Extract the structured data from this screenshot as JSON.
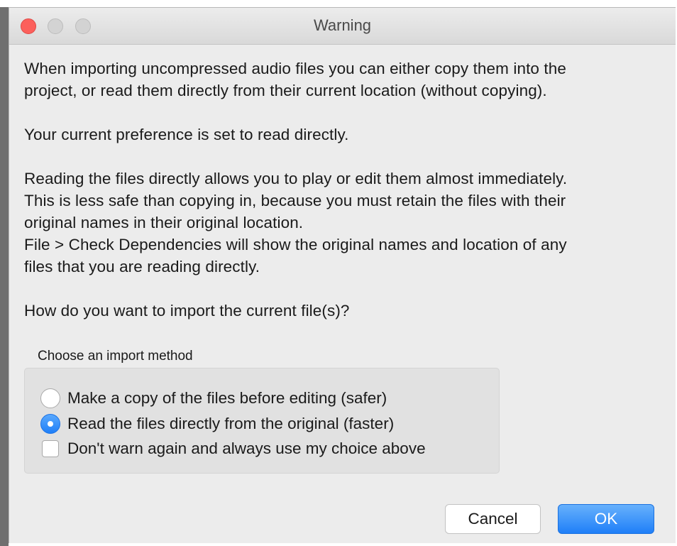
{
  "window": {
    "title": "Warning"
  },
  "message": {
    "para1_line1": "When importing uncompressed audio files you can either copy them into the",
    "para1_line2": "project, or read them directly from their current location (without copying).",
    "para2": "Your current preference is set to read directly.",
    "para3_line1": "Reading the files directly allows you to play or edit them almost immediately.",
    "para3_line2": "This is less safe than copying in, because you must retain the files with their",
    "para3_line3": "original names in their original location.",
    "para3_line4": "File > Check Dependencies will show the original names and location of any",
    "para3_line5": "files that you are reading directly.",
    "question": "How do you want to import the current file(s)?"
  },
  "import_method": {
    "group_label": "Choose an import method",
    "options": [
      {
        "label": "Make a copy of the files before editing (safer)",
        "selected": false
      },
      {
        "label": "Read the files directly from the original (faster)",
        "selected": true
      }
    ],
    "dont_warn_label": "Don't warn again and always use my choice above",
    "dont_warn_checked": false
  },
  "buttons": {
    "cancel": "Cancel",
    "ok": "OK"
  },
  "colors": {
    "accent": "#1f7ff8",
    "close": "#fc605c",
    "window_bg": "#ececec"
  }
}
